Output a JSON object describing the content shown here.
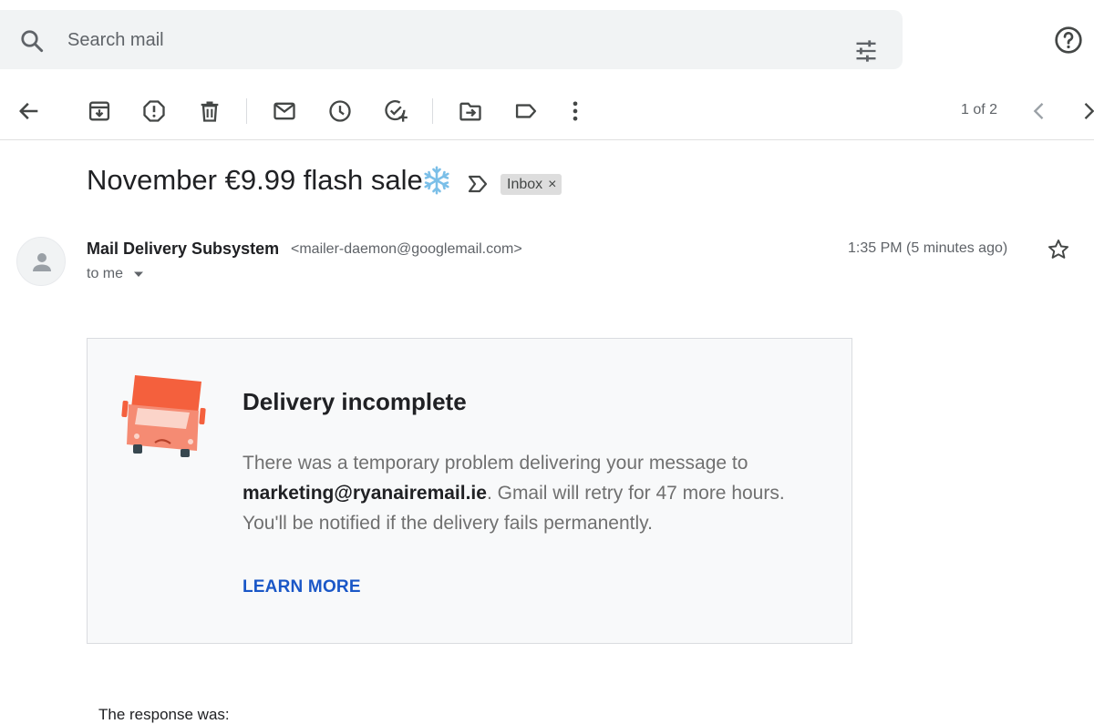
{
  "search": {
    "placeholder": "Search mail"
  },
  "toolbar": {
    "back_icon": "arrow-back-icon",
    "archive_icon": "archive-icon",
    "spam_icon": "report-spam-icon",
    "delete_icon": "trash-icon",
    "mark_unread_icon": "envelope-icon",
    "snooze_icon": "clock-icon",
    "add_task_icon": "add-task-icon",
    "move_icon": "move-to-icon",
    "label_icon": "label-icon",
    "more_icon": "more-vert-icon"
  },
  "pager": {
    "text": "1 of 2"
  },
  "email": {
    "subject": "November €9.99 flash sale",
    "label_chip": "Inbox",
    "label_chip_close": "×",
    "sender_name": "Mail Delivery Subsystem",
    "sender_email": "<mailer-daemon@googlemail.com>",
    "recipient": "to me",
    "timestamp": "1:35 PM (5 minutes ago)"
  },
  "card": {
    "title": "Delivery incomplete",
    "body_before": "There was a temporary problem delivering your message to ",
    "body_address": "marketing@ryanairemail.ie",
    "body_after": ". Gmail will retry for 47 more hours. You'll be notified if the delivery fails permanently.",
    "link": "LEARN MORE"
  },
  "response_label": "The response was:",
  "colors": {
    "truck": "#f4603d",
    "truck_light": "#f58b73",
    "link": "#1a57c7",
    "search_bg": "#f1f3f4",
    "card_bg": "#f8f9fa"
  }
}
